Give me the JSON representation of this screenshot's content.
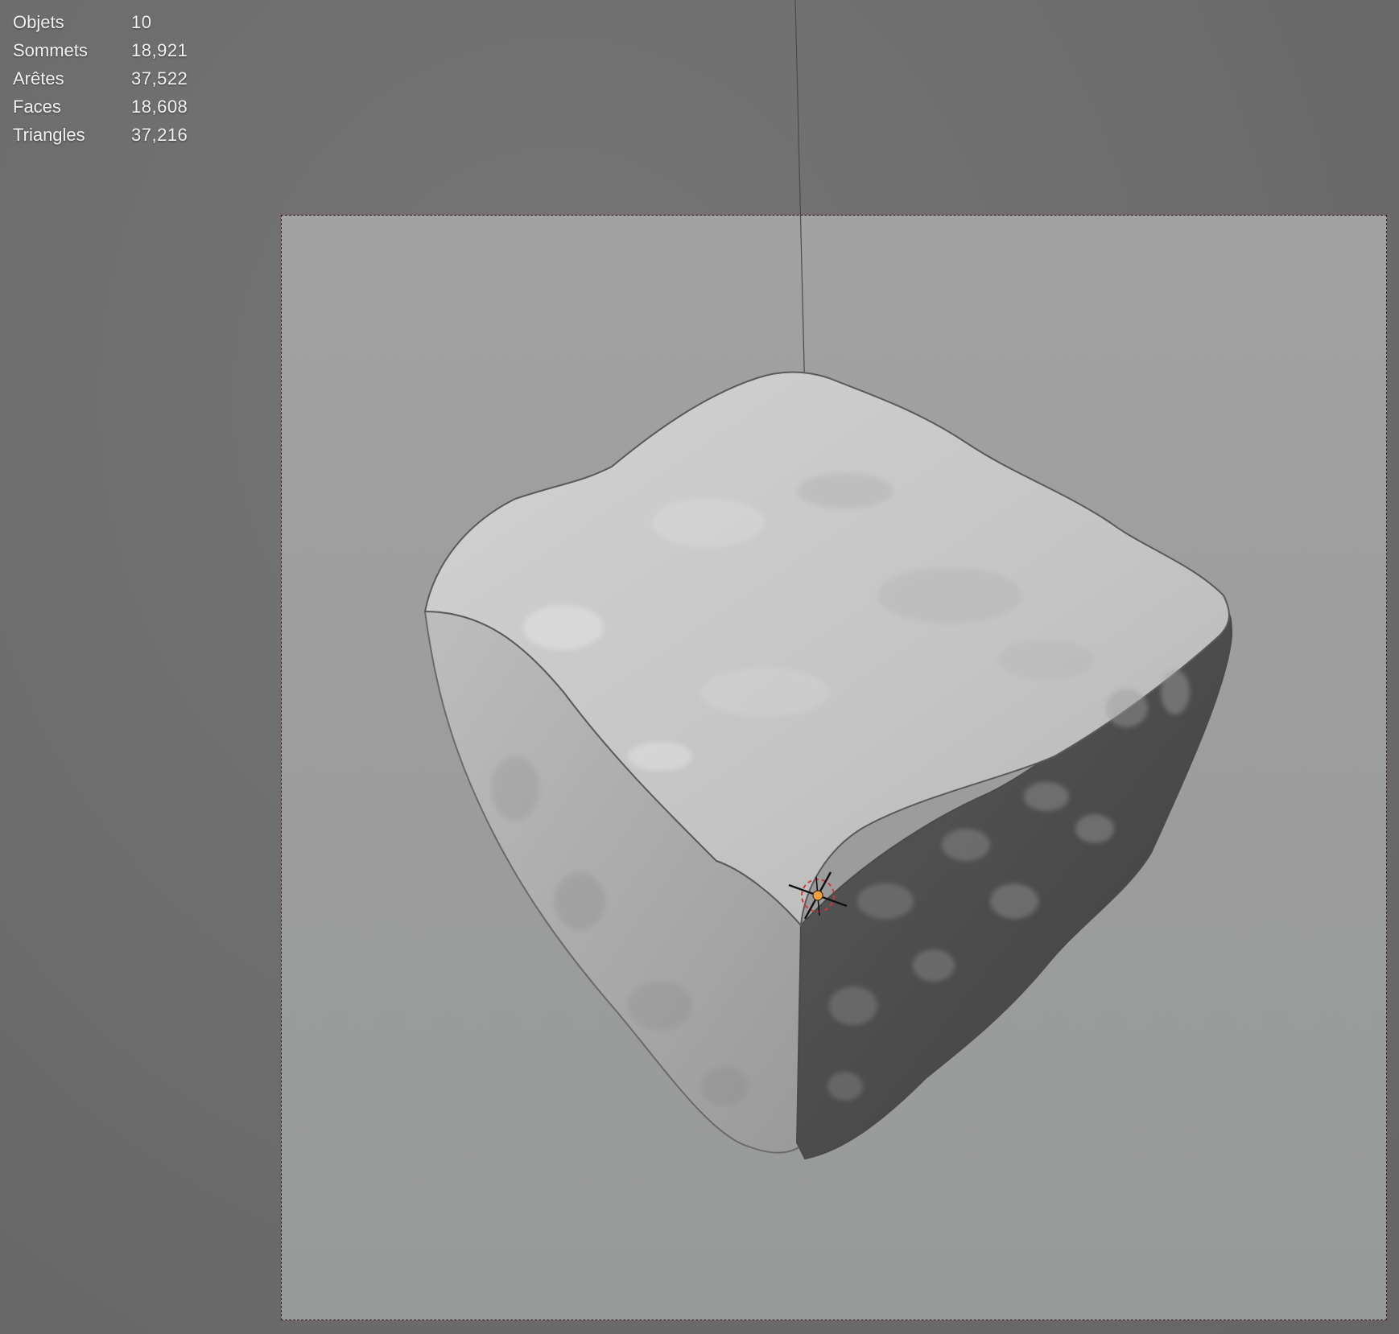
{
  "viewport_stats": [
    {
      "label": "Objets",
      "value": "10"
    },
    {
      "label": "Sommets",
      "value": "18,921"
    },
    {
      "label": "Arêtes",
      "value": "37,522"
    },
    {
      "label": "Faces",
      "value": "18,608"
    },
    {
      "label": "Triangles",
      "value": "37,216"
    }
  ],
  "colors": {
    "viewport_bg": "#6e6e6e",
    "camera_frame_bg": "#9e9e9e",
    "rock_light": "#cfcfcf",
    "rock_dark": "#4a4a4a",
    "origin_dot": "#f0a040"
  },
  "icons": {
    "origin": "object-origin-icon",
    "cursor": "3d-cursor-icon"
  }
}
